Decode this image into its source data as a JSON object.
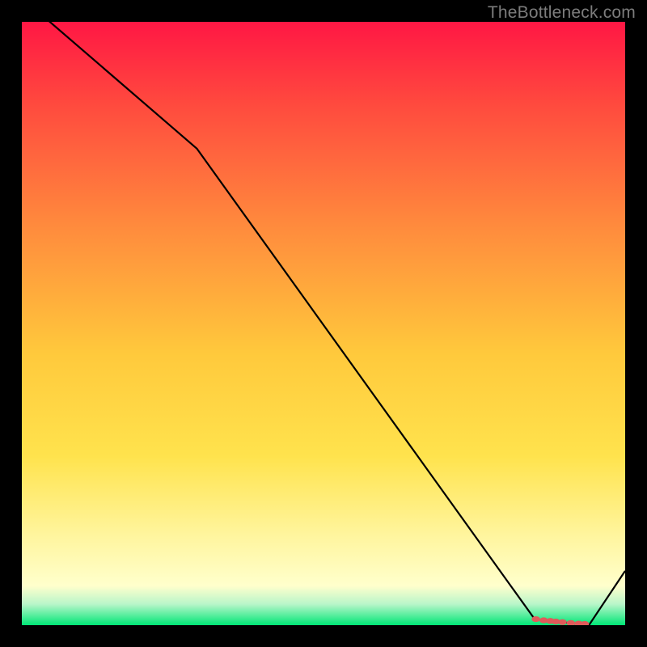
{
  "watermark": "TheBottleneck.com",
  "colors": {
    "gradient_top": "#ff1744",
    "gradient_upper": "#ff4b3e",
    "gradient_mid_upper": "#ff8b3d",
    "gradient_mid": "#ffc93c",
    "gradient_mid_lower": "#ffe34d",
    "gradient_lower": "#fff59d",
    "gradient_near_bottom": "#ffffcc",
    "gradient_bottom_band": "#b9f6ca",
    "gradient_bottom": "#00e676",
    "line": "#000000",
    "marker": "#e05a5a",
    "bg": "#000000"
  },
  "chart_data": {
    "type": "line",
    "title": "",
    "xlabel": "",
    "ylabel": "",
    "xlim": [
      0,
      100
    ],
    "ylim": [
      0,
      100
    ],
    "series": [
      {
        "name": "curve",
        "x": [
          0,
          29,
          85,
          94,
          100
        ],
        "values": [
          104,
          79,
          1,
          0,
          9
        ]
      }
    ],
    "markers": {
      "name": "highlighted-points",
      "x": [
        85.2,
        86.5,
        87.6,
        88.5,
        89.6,
        91.0,
        92.3,
        93.3
      ],
      "values": [
        1.0,
        0.8,
        0.7,
        0.6,
        0.5,
        0.35,
        0.25,
        0.2
      ]
    }
  }
}
